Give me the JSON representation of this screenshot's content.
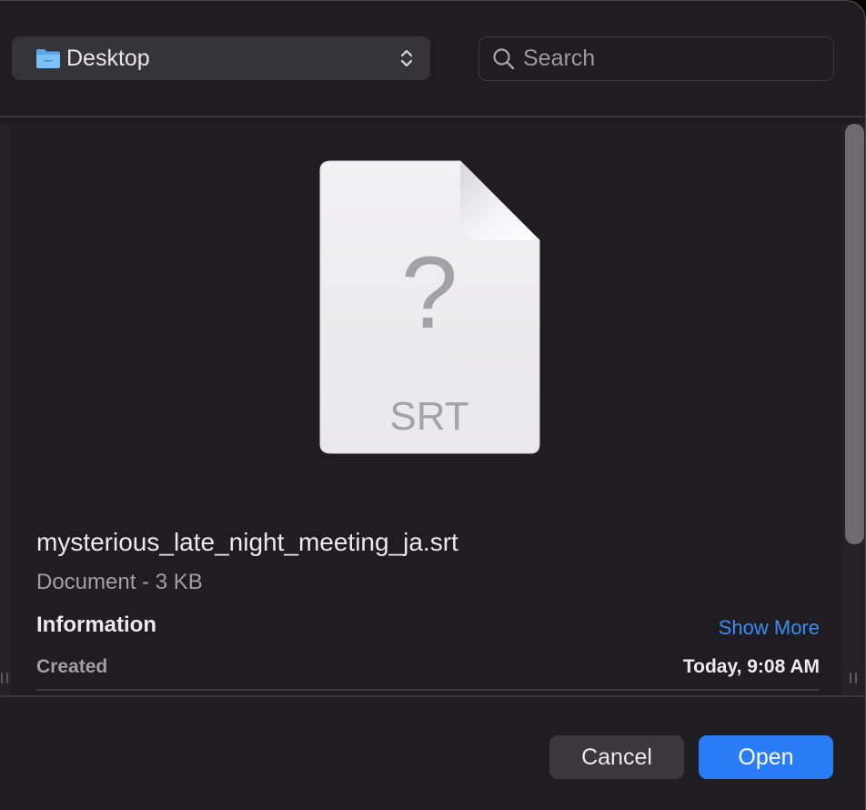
{
  "toolbar": {
    "location_label": "Desktop",
    "search_placeholder": "Search"
  },
  "preview": {
    "file_type_label": "SRT",
    "file_name": "mysterious_late_night_meeting_ja.srt",
    "file_kind": "Document - 3 KB",
    "info_heading": "Information",
    "show_more_label": "Show More",
    "created_label": "Created",
    "created_value": "Today, 9:08 AM"
  },
  "buttons": {
    "cancel_label": "Cancel",
    "open_label": "Open"
  },
  "colors": {
    "window_bg": "#1f1d21",
    "accent": "#2a7df6",
    "link": "#3b8cf2"
  },
  "icons": [
    "folder-icon",
    "updown-chevron-icon",
    "search-icon",
    "document-unknown-icon"
  ]
}
